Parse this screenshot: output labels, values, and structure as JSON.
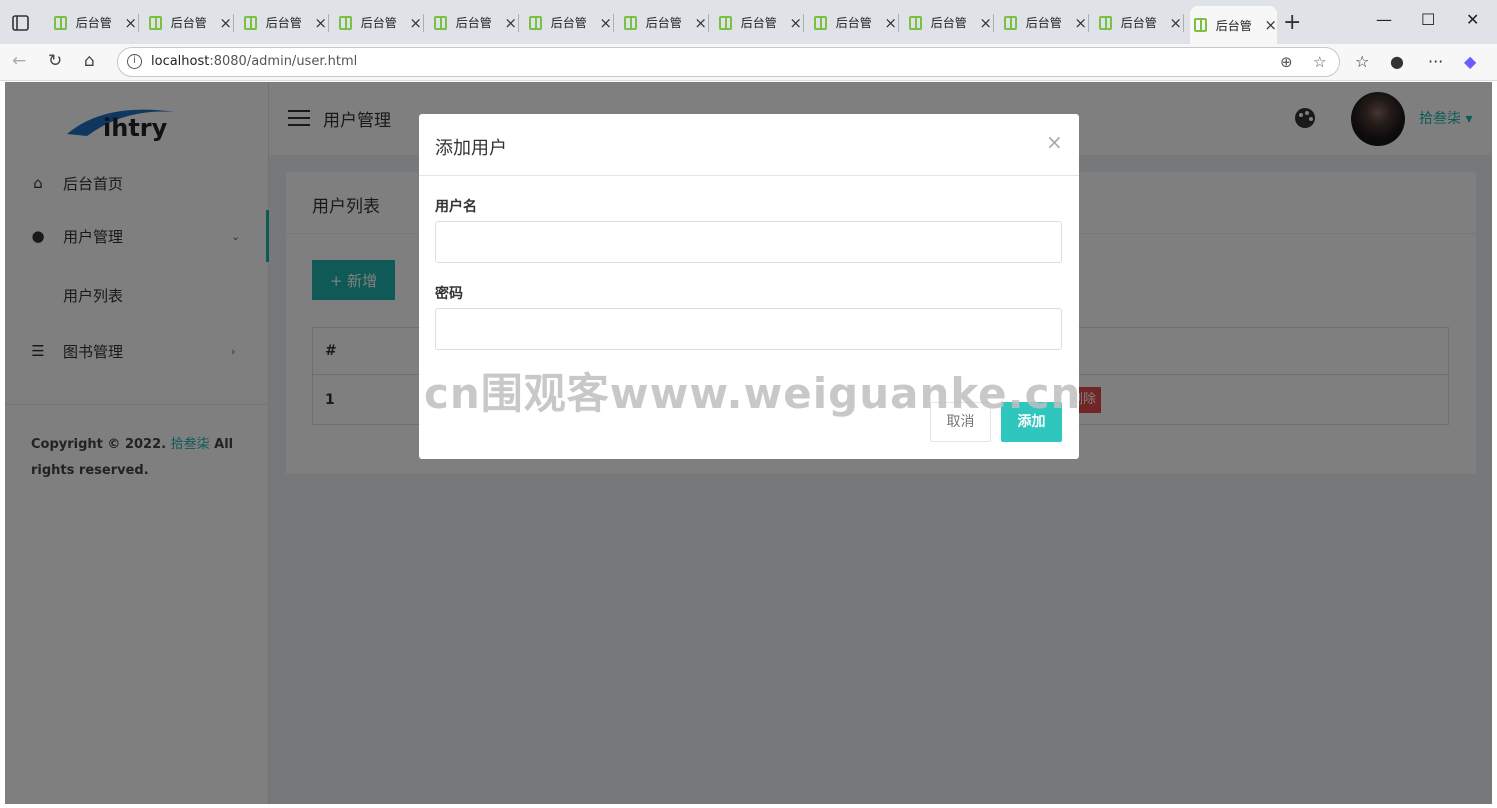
{
  "browser": {
    "tab_title": "后台管",
    "tabs_count": 13,
    "url_host": "localhost",
    "url_path": ":8080/admin/user.html"
  },
  "sidebar": {
    "logo_text": "ihtry",
    "items": [
      {
        "label": "后台首页",
        "icon": "home-icon"
      },
      {
        "label": "用户管理",
        "icon": "user-icon"
      },
      {
        "label": "图书管理",
        "icon": "list-icon"
      }
    ],
    "sub_item": "用户列表",
    "copyright_prefix": "Copyright © 2022.",
    "copyright_name": "拾叁柒",
    "copyright_suffix": "All rights reserved."
  },
  "header": {
    "title": "用户管理",
    "username": "拾叁柒"
  },
  "panel": {
    "title": "用户列表",
    "new_button": "+ 新增",
    "table_header": "#",
    "row_index": "1",
    "delete_label": "删除"
  },
  "modal": {
    "title": "添加用户",
    "close": "×",
    "username_label": "用户名",
    "password_label": "密码",
    "cancel_label": "取消",
    "submit_label": "添加"
  },
  "watermark": "cn围观客www.weiguanke.cn",
  "colors": {
    "accent": "#1fb5ad",
    "danger": "#e34a4a"
  }
}
